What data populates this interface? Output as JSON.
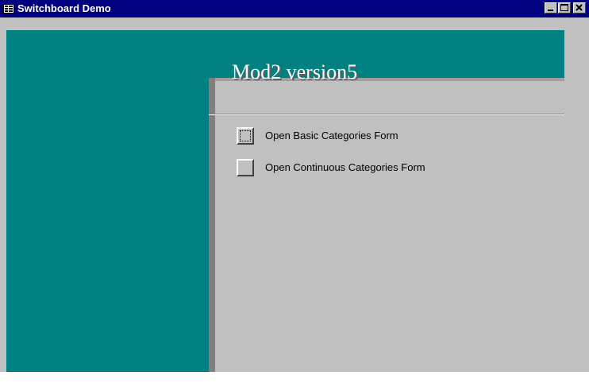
{
  "window": {
    "title": "Switchboard Demo",
    "icon": "form-icon"
  },
  "caption_buttons": {
    "minimize": "minimize-icon",
    "maximize": "maximize-icon",
    "close": "close-icon"
  },
  "switchboard": {
    "title": "Mod2 version5",
    "items": [
      {
        "label": "Open Basic Categories Form",
        "focused": true
      },
      {
        "label": "Open Continuous Categories Form",
        "focused": false
      }
    ]
  },
  "colors": {
    "title_bar": "#000080",
    "accent_teal": "#008080",
    "form_background": "#c0c0c0",
    "title_text": "#ffffff"
  }
}
